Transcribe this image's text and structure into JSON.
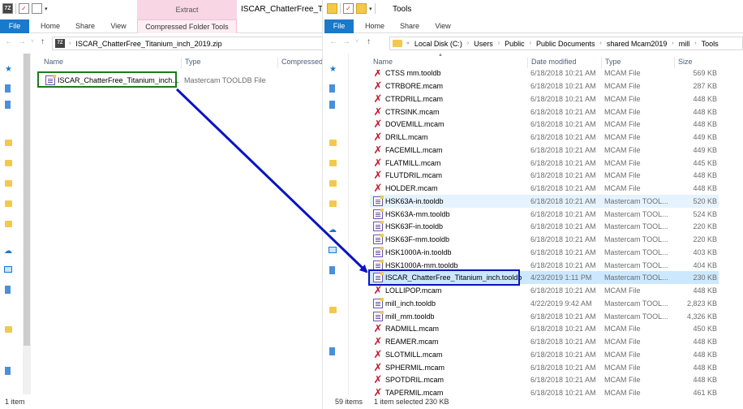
{
  "left": {
    "title": "ISCAR_ChatterFree_Titani",
    "extract_tab": "Extract",
    "ribbon": {
      "file": "File",
      "home": "Home",
      "share": "Share",
      "view": "View",
      "compressed": "Compressed Folder Tools"
    },
    "address": "ISCAR_ChatterFree_Titanium_inch_2019.zip",
    "columns": {
      "name": "Name",
      "type": "Type",
      "compressed": "Compressed"
    },
    "files": [
      {
        "name": "ISCAR_ChatterFree_Titanium_inch....",
        "type": "Mastercam TOOLDB File"
      }
    ],
    "status": "1 item",
    "highlight_color": "#1a7a1a"
  },
  "right": {
    "title": "Tools",
    "ribbon": {
      "file": "File",
      "home": "Home",
      "share": "Share",
      "view": "View"
    },
    "breadcrumb": [
      "Local Disk (C:)",
      "Users",
      "Public",
      "Public Documents",
      "shared Mcam2019",
      "mill",
      "Tools"
    ],
    "columns": {
      "name": "Name",
      "date": "Date modified",
      "type": "Type",
      "size": "Size"
    },
    "partial_top": {
      "name": "CTSS mm.tooldb",
      "date": "6/18/2018 10:21 AM",
      "type": "MCAM File",
      "size": "569 KB"
    },
    "files": [
      {
        "name": "CTRBORE.mcam",
        "date": "6/18/2018 10:21 AM",
        "type": "MCAM File",
        "size": "287 KB",
        "icon": "mcam"
      },
      {
        "name": "CTRDRILL.mcam",
        "date": "6/18/2018 10:21 AM",
        "type": "MCAM File",
        "size": "448 KB",
        "icon": "mcam"
      },
      {
        "name": "CTRSINK.mcam",
        "date": "6/18/2018 10:21 AM",
        "type": "MCAM File",
        "size": "448 KB",
        "icon": "mcam"
      },
      {
        "name": "DOVEMILL.mcam",
        "date": "6/18/2018 10:21 AM",
        "type": "MCAM File",
        "size": "448 KB",
        "icon": "mcam"
      },
      {
        "name": "DRILL.mcam",
        "date": "6/18/2018 10:21 AM",
        "type": "MCAM File",
        "size": "449 KB",
        "icon": "mcam"
      },
      {
        "name": "FACEMILL.mcam",
        "date": "6/18/2018 10:21 AM",
        "type": "MCAM File",
        "size": "449 KB",
        "icon": "mcam"
      },
      {
        "name": "FLATMILL.mcam",
        "date": "6/18/2018 10:21 AM",
        "type": "MCAM File",
        "size": "445 KB",
        "icon": "mcam"
      },
      {
        "name": "FLUTDRIL.mcam",
        "date": "6/18/2018 10:21 AM",
        "type": "MCAM File",
        "size": "448 KB",
        "icon": "mcam"
      },
      {
        "name": "HOLDER.mcam",
        "date": "6/18/2018 10:21 AM",
        "type": "MCAM File",
        "size": "448 KB",
        "icon": "mcam"
      },
      {
        "name": "HSK63A-in.tooldb",
        "date": "6/18/2018 10:21 AM",
        "type": "Mastercam TOOL...",
        "size": "520 KB",
        "icon": "tooldb",
        "state": "hover"
      },
      {
        "name": "HSK63A-mm.tooldb",
        "date": "6/18/2018 10:21 AM",
        "type": "Mastercam TOOL...",
        "size": "524 KB",
        "icon": "tooldb"
      },
      {
        "name": "HSK63F-in.tooldb",
        "date": "6/18/2018 10:21 AM",
        "type": "Mastercam TOOL...",
        "size": "220 KB",
        "icon": "tooldb"
      },
      {
        "name": "HSK63F-mm.tooldb",
        "date": "6/18/2018 10:21 AM",
        "type": "Mastercam TOOL...",
        "size": "220 KB",
        "icon": "tooldb"
      },
      {
        "name": "HSK1000A-in.tooldb",
        "date": "6/18/2018 10:21 AM",
        "type": "Mastercam TOOL...",
        "size": "403 KB",
        "icon": "tooldb"
      },
      {
        "name": "HSK1000A-mm.tooldb",
        "date": "6/18/2018 10:21 AM",
        "type": "Mastercam TOOL...",
        "size": "404 KB",
        "icon": "tooldb"
      },
      {
        "name": "ISCAR_ChatterFree_Titanium_inch.tooldb",
        "date": "4/23/2019 1:11 PM",
        "type": "Mastercam TOOL...",
        "size": "230 KB",
        "icon": "tooldb",
        "state": "selected"
      },
      {
        "name": "LOLLIPOP.mcam",
        "date": "6/18/2018 10:21 AM",
        "type": "MCAM File",
        "size": "448 KB",
        "icon": "mcam"
      },
      {
        "name": "mill_inch.tooldb",
        "date": "4/22/2019 9:42 AM",
        "type": "Mastercam TOOL...",
        "size": "2,823 KB",
        "icon": "tooldb"
      },
      {
        "name": "mill_mm.tooldb",
        "date": "6/18/2018 10:21 AM",
        "type": "Mastercam TOOL...",
        "size": "4,326 KB",
        "icon": "tooldb"
      },
      {
        "name": "RADMILL.mcam",
        "date": "6/18/2018 10:21 AM",
        "type": "MCAM File",
        "size": "450 KB",
        "icon": "mcam"
      },
      {
        "name": "REAMER.mcam",
        "date": "6/18/2018 10:21 AM",
        "type": "MCAM File",
        "size": "448 KB",
        "icon": "mcam"
      },
      {
        "name": "SLOTMILL.mcam",
        "date": "6/18/2018 10:21 AM",
        "type": "MCAM File",
        "size": "448 KB",
        "icon": "mcam"
      },
      {
        "name": "SPHERMIL.mcam",
        "date": "6/18/2018 10:21 AM",
        "type": "MCAM File",
        "size": "448 KB",
        "icon": "mcam"
      },
      {
        "name": "SPOTDRIL.mcam",
        "date": "6/18/2018 10:21 AM",
        "type": "MCAM File",
        "size": "448 KB",
        "icon": "mcam"
      },
      {
        "name": "TAPERMIL.mcam",
        "date": "6/18/2018 10:21 AM",
        "type": "MCAM File",
        "size": "461 KB",
        "icon": "mcam"
      }
    ],
    "status": {
      "count": "59 items",
      "selected": "1 item selected  230 KB"
    },
    "highlight_color": "#0b13c2"
  },
  "arrow_color": "#0b13c2"
}
